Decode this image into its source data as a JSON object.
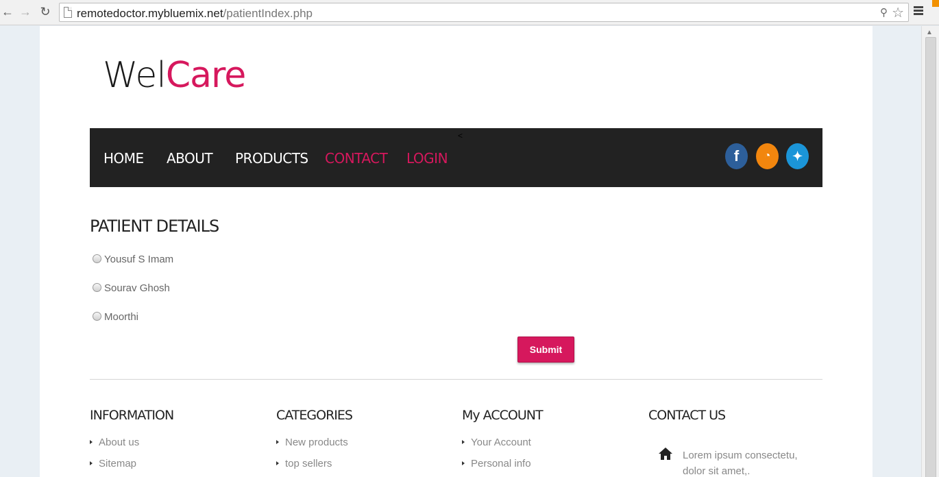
{
  "browser": {
    "url_host": "remotedoctor.mybluemix.net",
    "url_path": "/patientIndex.php"
  },
  "logo": {
    "part1": "Wel",
    "part2": "Care"
  },
  "nav": {
    "home": "HOME",
    "about": "ABOUT",
    "products": "PRODUCTS",
    "contact": "CONTACT",
    "login": "LOGIN",
    "cursor": "<",
    "accent_color": "#d6185d"
  },
  "social": {
    "facebook": "f",
    "rss": "◔",
    "twitter": "✦"
  },
  "patients": {
    "title": "PATIENT DETAILS",
    "options": [
      "Yousuf S Imam",
      "Sourav Ghosh",
      "Moorthi"
    ],
    "submit_label": "Submit"
  },
  "footer": {
    "information": {
      "title": "INFORMATION",
      "links": [
        "About us",
        "Sitemap"
      ]
    },
    "categories": {
      "title": "CATEGORIES",
      "links": [
        "New products",
        "top sellers"
      ]
    },
    "account": {
      "title": "My ACCOUNT",
      "links": [
        "Your Account",
        "Personal info"
      ]
    },
    "contact": {
      "title": "CONTACT US",
      "line1": "Lorem ipsum consectetu,",
      "line2": "dolor sit amet,."
    }
  }
}
